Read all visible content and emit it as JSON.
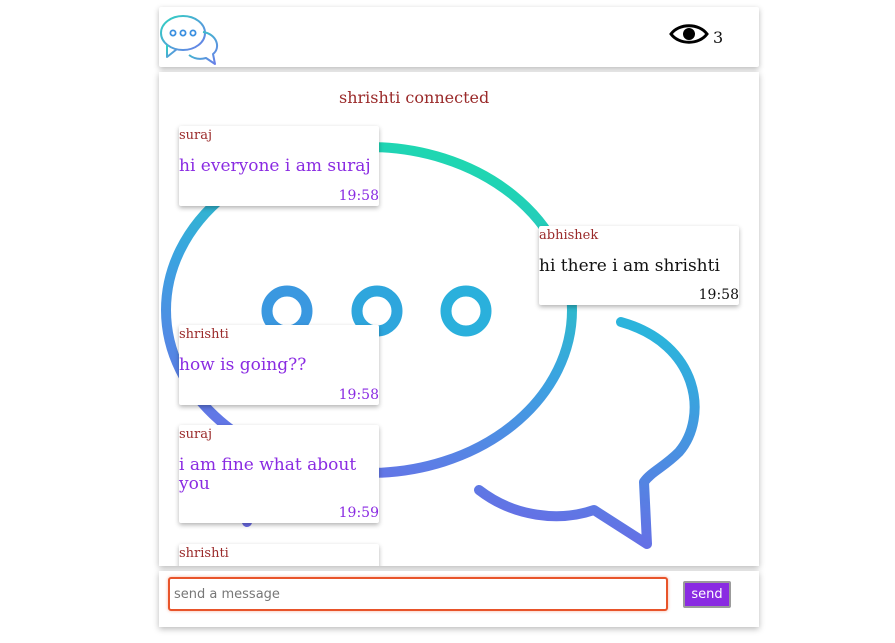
{
  "header": {
    "logo_icon": "chat-bubbles-icon",
    "viewer_icon": "eye-icon",
    "viewer_count": "3"
  },
  "chat": {
    "background_icon": "chat-bubbles-icon",
    "notice": "shrishti connected",
    "messages": [
      {
        "sender": "suraj",
        "text": "hi everyone i am suraj",
        "time": "19:58",
        "side": "left"
      },
      {
        "sender": "abhishek",
        "text": "hi there i am shrishti",
        "time": "19:58",
        "side": "right"
      },
      {
        "sender": "shrishti",
        "text": "how is going??",
        "time": "19:58",
        "side": "left"
      },
      {
        "sender": "suraj",
        "text": "i am fine what about you",
        "time": "19:59",
        "side": "left"
      },
      {
        "sender": "shrishti",
        "text": "",
        "time": "",
        "side": "left"
      }
    ]
  },
  "composer": {
    "placeholder": "send a message",
    "value": "",
    "send_label": "send"
  },
  "colors": {
    "accent": "#8a2be2",
    "sender": "#9a2a2a",
    "input_border": "#e8542a",
    "gradient_teal": "#1ed8b0",
    "gradient_blue": "#3f8ee0",
    "gradient_violet": "#6c6ce8"
  }
}
